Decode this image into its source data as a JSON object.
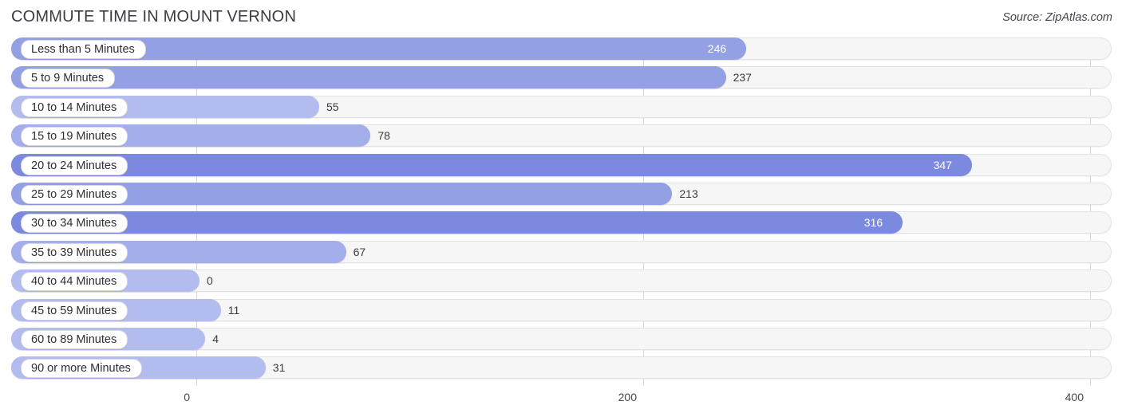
{
  "header": {
    "title": "COMMUTE TIME IN MOUNT VERNON",
    "source": "Source: ZipAtlas.com"
  },
  "colors": {
    "bar_high": "#7b8ade",
    "bar_mid": "#93a0e4",
    "bar_low": "#b3bcee",
    "track": "#f6f6f7",
    "track_border": "#e3e3e6",
    "gridline": "#d8d8dc",
    "title_text": "#3b3b44",
    "value_text_outside": "#3a3a42",
    "value_text_inside": "#ffffff"
  },
  "chart_data": {
    "type": "bar",
    "orientation": "horizontal",
    "title": "COMMUTE TIME IN MOUNT VERNON",
    "xlabel": "",
    "ylabel": "",
    "xlim": [
      0,
      400
    ],
    "xticks": [
      0,
      200,
      400
    ],
    "xtick_labels": [
      "0",
      "200",
      "400"
    ],
    "grid": true,
    "legend": "none",
    "categories": [
      "Less than 5 Minutes",
      "5 to 9 Minutes",
      "10 to 14 Minutes",
      "15 to 19 Minutes",
      "20 to 24 Minutes",
      "25 to 29 Minutes",
      "30 to 34 Minutes",
      "35 to 39 Minutes",
      "40 to 44 Minutes",
      "45 to 59 Minutes",
      "60 to 89 Minutes",
      "90 or more Minutes"
    ],
    "values": [
      246,
      237,
      55,
      78,
      347,
      213,
      316,
      67,
      0,
      11,
      4,
      31
    ],
    "value_labels": [
      "246",
      "237",
      "55",
      "78",
      "347",
      "213",
      "316",
      "67",
      "0",
      "11",
      "4",
      "31"
    ],
    "label_placement": [
      "inside",
      "outside",
      "outside",
      "outside",
      "inside",
      "outside",
      "inside",
      "outside",
      "outside",
      "outside",
      "outside",
      "outside"
    ]
  }
}
